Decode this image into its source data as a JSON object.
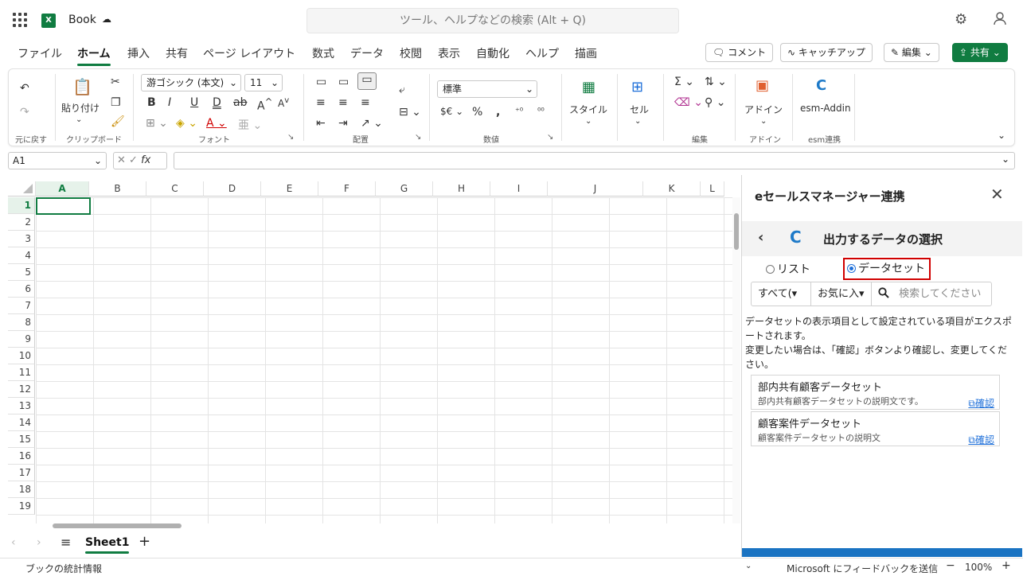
{
  "titlebar": {
    "app_badge": "X",
    "book_title": "Book",
    "search_placeholder": "ツール、ヘルプなどの検索 (Alt + Q)"
  },
  "menu": {
    "tabs": [
      "ファイル",
      "ホーム",
      "挿入",
      "共有",
      "ページ レイアウト",
      "数式",
      "データ",
      "校閲",
      "表示",
      "自動化",
      "ヘルプ",
      "描画"
    ],
    "active_tab": "ホーム",
    "comment_label": "コメント",
    "catchup_label": "キャッチアップ",
    "edit_label": "編集",
    "share_label": "共有"
  },
  "ribbon": {
    "undo_label": "元に戻す",
    "paste_label": "貼り付け",
    "clipboard_label": "クリップボード",
    "font_name": "游ゴシック (本文)",
    "font_size": "11",
    "font_label": "フォント",
    "align_label": "配置",
    "number_format": "標準",
    "number_label": "数値",
    "style_label": "スタイル",
    "cell_label": "セル",
    "edit_group_label": "編集",
    "addin_label": "アドイン",
    "addin_group_label": "アドイン",
    "esm_label": "esm-Addin",
    "esm_group_label": "esm連携"
  },
  "formula": {
    "namebox": "A1",
    "fx": "fx"
  },
  "grid": {
    "columns": [
      "A",
      "B",
      "C",
      "D",
      "E",
      "F",
      "G",
      "H",
      "I",
      "J",
      "K",
      "L"
    ],
    "rows": [
      "1",
      "2",
      "3",
      "4",
      "5",
      "6",
      "7",
      "8",
      "9",
      "10",
      "11",
      "12",
      "13",
      "14",
      "15",
      "16",
      "17",
      "18",
      "19"
    ],
    "active_cell": "A1"
  },
  "sheets": {
    "active": "Sheet1"
  },
  "status": {
    "left": "ブックの統計情報",
    "feedback": "Microsoft にフィードバックを送信",
    "zoom": "100%"
  },
  "pane": {
    "title": "eセールスマネージャー連携",
    "heading": "出力するデータの選択",
    "radio_list": "リスト",
    "radio_dataset": "データセット",
    "selected": "データセット",
    "filter_all": "すべて(",
    "filter_fav": "お気に入",
    "search_placeholder": "検索してください",
    "desc1": "データセットの表示項目として設定されている項目がエクスポートされます。",
    "desc2": "変更したい場合は、「確認」ボタンより確認し、変更してください。",
    "items": [
      {
        "title": "部内共有顧客データセット",
        "desc": "部内共有顧客データセットの説明文です。",
        "link": "確認"
      },
      {
        "title": "顧客案件データセット",
        "desc": "顧客案件データセットの説明文",
        "link": "確認"
      }
    ]
  },
  "colors": {
    "accent": "#107c41",
    "highlight": "#d00000",
    "link": "#1e6fd9"
  }
}
